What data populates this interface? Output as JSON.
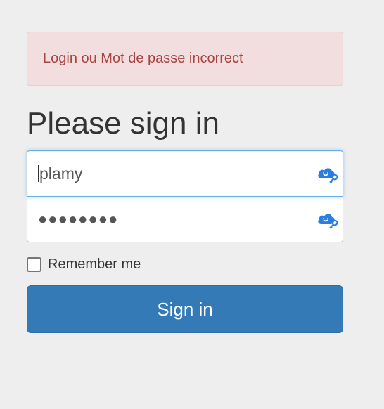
{
  "alert": {
    "message": "Login ou Mot de passe incorrect"
  },
  "form": {
    "heading": "Please sign in",
    "username_value": "plamy",
    "password_masked": "●●●●●●●●",
    "remember_label": "Remember me",
    "remember_checked": false,
    "submit_label": "Sign in"
  },
  "colors": {
    "background": "#eeeeee",
    "alert_bg": "#f2dede",
    "alert_text": "#a94442",
    "primary": "#337ab7",
    "focus_border": "#66afe9",
    "keepass_icon": "#2a7de1"
  },
  "icons": {
    "username_field_icon": "keepassxc-cloud-key-icon",
    "password_field_icon": "keepassxc-cloud-key-icon"
  }
}
